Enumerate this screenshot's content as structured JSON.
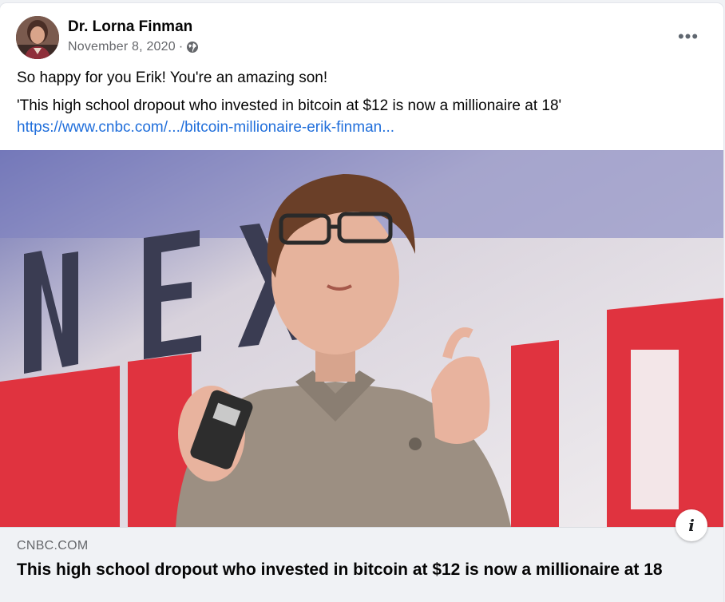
{
  "post": {
    "author": "Dr. Lorna Finman",
    "date": "November 8, 2020",
    "separator": "·",
    "privacy_icon": "globe-icon",
    "more_icon": "more-options-icon",
    "more_label": "•••",
    "caption": "So happy for you Erik! You're an amazing son!",
    "quote": "'This high school dropout who invested in bitcoin at $12 is now a millionaire at 18'",
    "link": "https://www.cnbc.com/.../bitcoin-millionaire-erik-finman..."
  },
  "link_preview": {
    "domain": "CNBC.COM",
    "title": "This high school dropout who invested in bitcoin at $12 is now a millionaire at 18",
    "info_icon": "info-icon",
    "info_label": "i"
  },
  "colors": {
    "link": "#216fdb",
    "secondary_text": "#65676b",
    "preview_bg": "#f0f2f5"
  }
}
